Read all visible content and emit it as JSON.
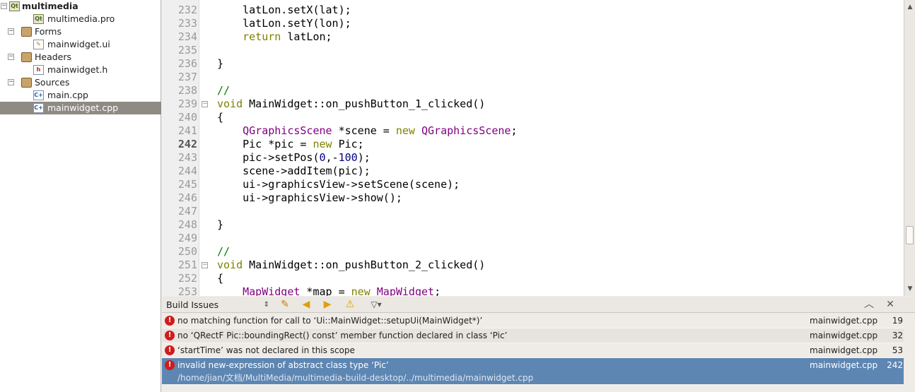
{
  "project_tree": {
    "project": {
      "label": "multimedia"
    },
    "items": [
      {
        "label": "multimedia.pro",
        "kind": "file",
        "icon": "pro-file-icon",
        "depth": 1
      },
      {
        "label": "Forms",
        "kind": "folder",
        "icon": "forms-folder-icon",
        "depth": 0,
        "expanded": true
      },
      {
        "label": "mainwidget.ui",
        "kind": "file",
        "icon": "ui-file-icon",
        "depth": 1
      },
      {
        "label": "Headers",
        "kind": "folder",
        "icon": "headers-folder-icon",
        "depth": 0,
        "expanded": true
      },
      {
        "label": "mainwidget.h",
        "kind": "file",
        "icon": "header-file-icon",
        "depth": 1
      },
      {
        "label": "Sources",
        "kind": "folder",
        "icon": "sources-folder-icon",
        "depth": 0,
        "expanded": true
      },
      {
        "label": "main.cpp",
        "kind": "file",
        "icon": "cpp-file-icon",
        "depth": 1
      },
      {
        "label": "mainwidget.cpp",
        "kind": "file",
        "icon": "cpp-file-icon",
        "depth": 1,
        "selected": true
      }
    ]
  },
  "editor": {
    "current_line": "242",
    "lines": [
      {
        "num": "232",
        "fold": false
      },
      {
        "num": "233",
        "fold": false
      },
      {
        "num": "234",
        "fold": false
      },
      {
        "num": "235",
        "fold": false
      },
      {
        "num": "236",
        "fold": false
      },
      {
        "num": "237",
        "fold": false
      },
      {
        "num": "238",
        "fold": false
      },
      {
        "num": "239",
        "fold": true
      },
      {
        "num": "240",
        "fold": false
      },
      {
        "num": "241",
        "fold": false
      },
      {
        "num": "242",
        "fold": false
      },
      {
        "num": "243",
        "fold": false
      },
      {
        "num": "244",
        "fold": false
      },
      {
        "num": "245",
        "fold": false
      },
      {
        "num": "246",
        "fold": false
      },
      {
        "num": "247",
        "fold": false
      },
      {
        "num": "248",
        "fold": false
      },
      {
        "num": "249",
        "fold": false
      },
      {
        "num": "250",
        "fold": false
      },
      {
        "num": "251",
        "fold": true
      },
      {
        "num": "252",
        "fold": false
      },
      {
        "num": "253",
        "fold": false
      }
    ],
    "code": [
      [
        {
          "t": "    latLon.setX(lat);",
          "c": ""
        }
      ],
      [
        {
          "t": "    latLon.setY(lon);",
          "c": ""
        }
      ],
      [
        {
          "t": "    ",
          "c": ""
        },
        {
          "t": "return",
          "c": "kw"
        },
        {
          "t": " latLon;",
          "c": ""
        }
      ],
      [],
      [
        {
          "t": "}",
          "c": ""
        }
      ],
      [],
      [
        {
          "t": "//",
          "c": "cm"
        }
      ],
      [
        {
          "t": "void",
          "c": "kw"
        },
        {
          "t": " MainWidget::on_pushButton_1_clicked()",
          "c": ""
        }
      ],
      [
        {
          "t": "{",
          "c": ""
        }
      ],
      [
        {
          "t": "    ",
          "c": ""
        },
        {
          "t": "QGraphicsScene",
          "c": "ty"
        },
        {
          "t": " *scene = ",
          "c": ""
        },
        {
          "t": "new",
          "c": "kw"
        },
        {
          "t": " ",
          "c": ""
        },
        {
          "t": "QGraphicsScene",
          "c": "ty"
        },
        {
          "t": ";",
          "c": ""
        }
      ],
      [
        {
          "t": "    Pic *pic = ",
          "c": ""
        },
        {
          "t": "new",
          "c": "kw"
        },
        {
          "t": " Pic;",
          "c": ""
        }
      ],
      [
        {
          "t": "    pic->setPos(",
          "c": ""
        },
        {
          "t": "0",
          "c": "nm"
        },
        {
          "t": ",-",
          "c": ""
        },
        {
          "t": "100",
          "c": "nm"
        },
        {
          "t": ");",
          "c": ""
        }
      ],
      [
        {
          "t": "    scene->addItem(pic);",
          "c": ""
        }
      ],
      [
        {
          "t": "    ui->graphicsView->setScene(scene);",
          "c": ""
        }
      ],
      [
        {
          "t": "    ui->graphicsView->show();",
          "c": ""
        }
      ],
      [],
      [
        {
          "t": "}",
          "c": ""
        }
      ],
      [],
      [
        {
          "t": "//",
          "c": "cm"
        }
      ],
      [
        {
          "t": "void",
          "c": "kw"
        },
        {
          "t": " MainWidget::on_pushButton_2_clicked()",
          "c": ""
        }
      ],
      [
        {
          "t": "{",
          "c": ""
        }
      ],
      [
        {
          "t": "    ",
          "c": ""
        },
        {
          "t": "MapWidget",
          "c": "ty"
        },
        {
          "t": " *map = ",
          "c": ""
        },
        {
          "t": "new",
          "c": "kw"
        },
        {
          "t": " ",
          "c": ""
        },
        {
          "t": "MapWidget",
          "c": "ty"
        },
        {
          "t": ";",
          "c": ""
        }
      ]
    ]
  },
  "build_issues": {
    "title": "Build Issues",
    "toolbar": [
      "filter-warnings-icon",
      "previous-issue-icon",
      "next-issue-icon",
      "warning-toggle-icon",
      "filter-icon"
    ],
    "issues": [
      {
        "message": "no matching function for call to ‘Ui::MainWidget::setupUi(MainWidget*)’",
        "file": "mainwidget.cpp",
        "line": "19"
      },
      {
        "message": "no ‘QRectF Pic::boundingRect() const’ member function declared in class ‘Pic’",
        "file": "mainwidget.cpp",
        "line": "32"
      },
      {
        "message": "‘startTime’ was not declared in this scope",
        "file": "mainwidget.cpp",
        "line": "53"
      },
      {
        "message": "invalid new-expression of abstract class type ‘Pic’",
        "file": "mainwidget.cpp",
        "line": "242",
        "path": "/home/jian/文档/MultiMedia/multimedia-build-desktop/../multimedia/mainwidget.cpp",
        "selected": true
      }
    ]
  },
  "colors": {
    "selection": "#5e86b2",
    "error": "#d01c1c",
    "keyword": "#808000",
    "type": "#800080",
    "comment": "#008000",
    "number": "#000080"
  }
}
